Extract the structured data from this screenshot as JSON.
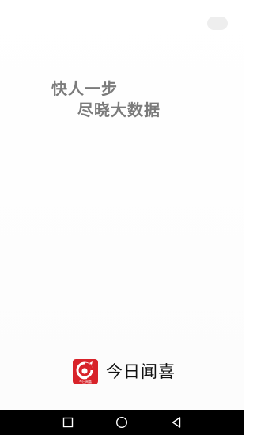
{
  "splash": {
    "slogan_line1": "快人一步",
    "slogan_line2": "尽晓大数据",
    "skip_button": ""
  },
  "brand": {
    "logo_text": "今日闻喜",
    "name": "今日闻喜",
    "logo_color": "#d8232a"
  },
  "navbar": {
    "icons": [
      "recent-apps-icon",
      "home-icon",
      "back-icon"
    ]
  }
}
